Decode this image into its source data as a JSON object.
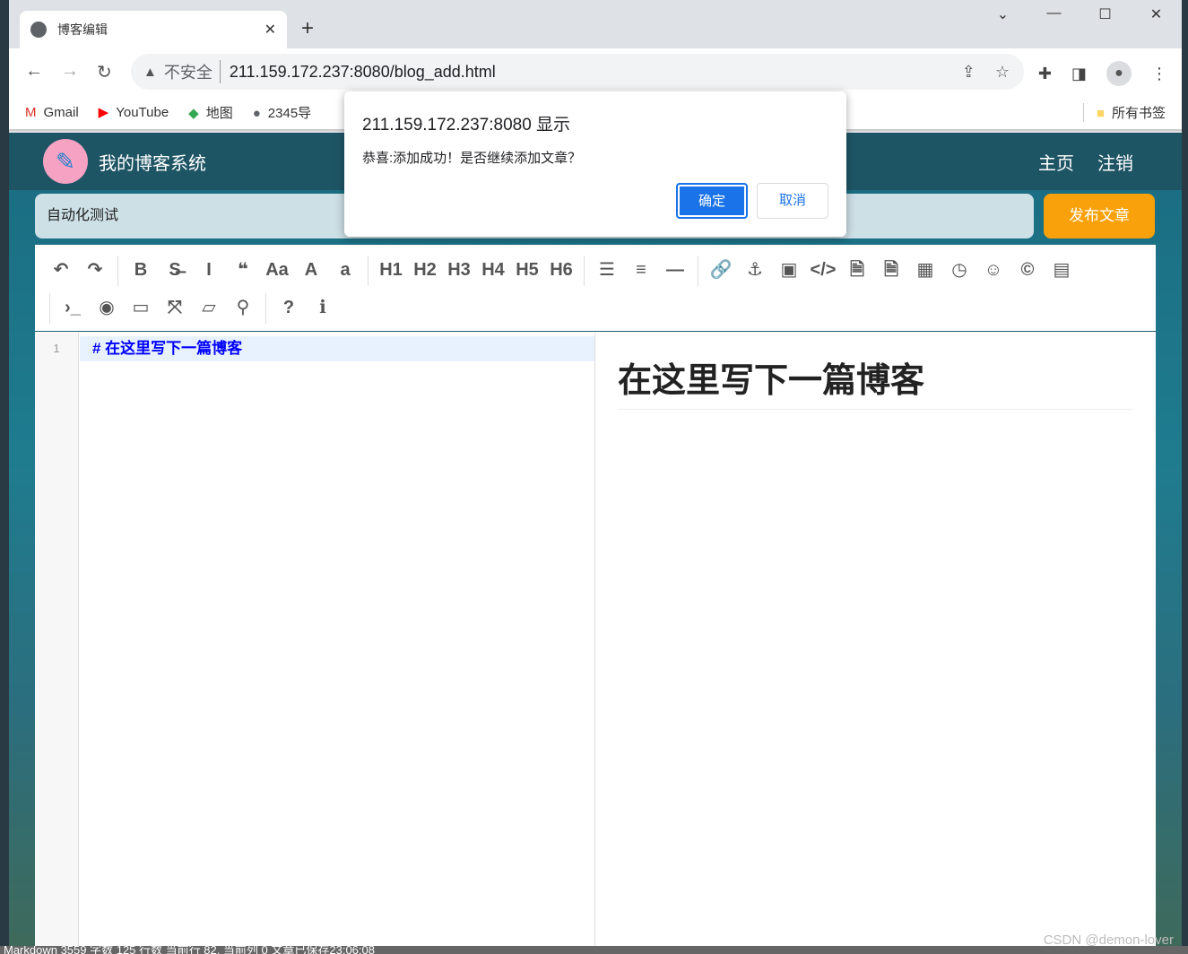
{
  "browser": {
    "tab_title": "博客编辑",
    "security": "不安全",
    "url": "211.159.172.237:8080/blog_add.html",
    "bookmarks": [
      {
        "label": "Gmail",
        "icon": "gmail-icon"
      },
      {
        "label": "YouTube",
        "icon": "youtube-icon"
      },
      {
        "label": "地图",
        "icon": "maps-icon"
      },
      {
        "label": "2345导",
        "icon": "globe-icon"
      }
    ],
    "all_bookmarks": "所有书签"
  },
  "site": {
    "name": "我的博客系统",
    "nav": [
      "主页",
      "注销"
    ]
  },
  "editor": {
    "title_value": "自动化测试",
    "publish_label": "发布文章",
    "toolbar_row1": [
      "↶",
      "↷",
      "|",
      "B",
      "S̶",
      "I",
      "❝",
      "Aa",
      "A",
      "a",
      "|",
      "H1",
      "H2",
      "H3",
      "H4",
      "H5",
      "H6",
      "|",
      "☰",
      "≡",
      "—",
      "|",
      "🔗",
      "⚓",
      "▣",
      "</>",
      "🗎",
      "🗎",
      "▦",
      "◷",
      "☺",
      "©",
      "▤"
    ],
    "toolbar_row2": [
      "|",
      "›_",
      "◉",
      "▭",
      "⤧",
      "▱",
      "⚲",
      "|",
      "?",
      "ℹ"
    ],
    "line_number": "1",
    "markdown": "#  在这里写下一篇博客",
    "preview_heading": "在这里写下一篇博客"
  },
  "status_bar": "Markdown  3559 字数  125 行数  当前行 82, 当前列 0  文章已保存23:06:08",
  "watermark": "CSDN @demon-lover",
  "dialog": {
    "title": "211.159.172.237:8080 显示",
    "message": "恭喜:添加成功！是否继续添加文章？",
    "ok": "确定",
    "cancel": "取消"
  },
  "colors": {
    "header": "#1e5565",
    "publish": "#f9a10a",
    "dialog_ok": "#1a73e8"
  }
}
